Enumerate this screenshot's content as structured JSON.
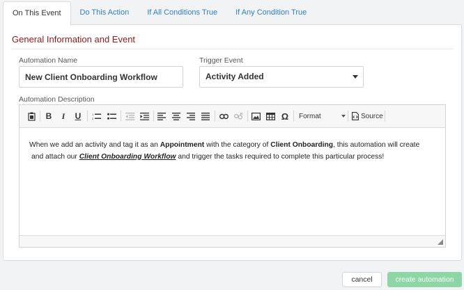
{
  "tabs": [
    {
      "label": "On This Event",
      "active": true
    },
    {
      "label": "Do This Action",
      "active": false
    },
    {
      "label": "If All Conditions True",
      "active": false
    },
    {
      "label": "If Any Condition True",
      "active": false
    }
  ],
  "section": {
    "title": "General Information and Event"
  },
  "form": {
    "name_label": "Automation Name",
    "name_value": "New Client Onboarding Workflow",
    "trigger_label": "Trigger Event",
    "trigger_value": "Activity Added",
    "description_label": "Automation Description"
  },
  "editor": {
    "toolbar": {
      "format_label": "Format",
      "source_label": "Source"
    },
    "content": {
      "p1_a": "When we add an activity and tag it as an ",
      "p1_b": "Appointment",
      "p1_c": " with the category of ",
      "p1_d": "Client Onboarding",
      "p1_e": ", this automation will create",
      "p2_a": "and attach our ",
      "p2_b": "Client Onboarding Workflow",
      "p2_c": " and trigger the tasks required to complete this particular process!"
    }
  },
  "footer": {
    "cancel_label": "cancel",
    "create_label": "create automation"
  },
  "colors": {
    "accent_link": "#2f7fc0",
    "section_title": "#8b1a1a",
    "create_button": "#8fd6a6"
  }
}
